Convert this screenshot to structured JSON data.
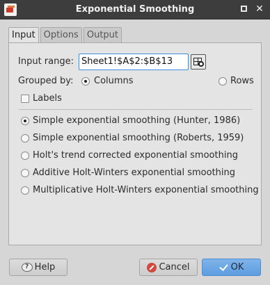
{
  "window": {
    "title": "Exponential Smoothing"
  },
  "tabs": [
    {
      "label": "Input",
      "active": true
    },
    {
      "label": "Options",
      "active": false
    },
    {
      "label": "Output",
      "active": false
    }
  ],
  "input": {
    "range_label": "Input range:",
    "range_value": "Sheet1!$A$2:$B$13",
    "grouped_by_label": "Grouped by:",
    "grouped_columns": "Columns",
    "grouped_rows": "Rows",
    "grouped_selected": "Columns",
    "labels_checkbox": "Labels",
    "labels_checked": false
  },
  "methods": {
    "selected": 0,
    "items": [
      "Simple exponential smoothing (Hunter, 1986)",
      "Simple exponential smoothing (Roberts, 1959)",
      "Holt's trend corrected exponential smoothing",
      "Additive Holt-Winters exponential smoothing",
      "Multiplicative Holt-Winters exponential smoothing"
    ]
  },
  "buttons": {
    "help": "Help",
    "cancel": "Cancel",
    "ok": "OK"
  },
  "colors": {
    "titlebar": "#3d3d3d",
    "accent": "#5d9de0",
    "cancel_icon": "#d24a3f"
  },
  "icons": [
    "app-icon",
    "restore-icon",
    "close-icon",
    "cell-range-picker-icon",
    "help-icon",
    "cancel-icon",
    "ok-check-icon"
  ]
}
